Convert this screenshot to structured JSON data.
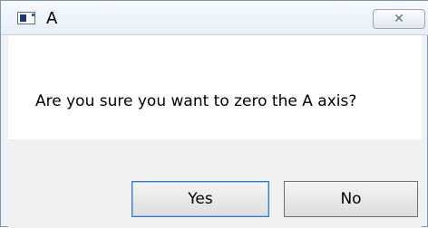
{
  "window": {
    "title": "A",
    "close_glyph": "✕",
    "icon": "app-icon"
  },
  "dialog": {
    "message": "Are you sure you want to zero the A axis?"
  },
  "buttons": {
    "yes_label": "Yes",
    "no_label": "No"
  }
}
